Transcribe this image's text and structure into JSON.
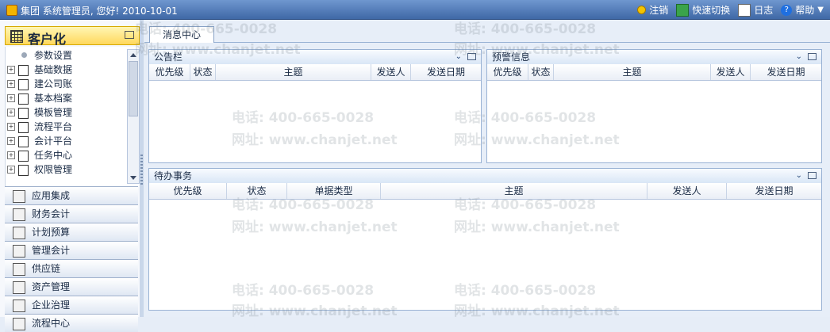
{
  "topbar": {
    "title": "集团 系统管理员, 您好! 2010-10-01",
    "actions": [
      "注销",
      "快速切换",
      "日志",
      "帮助"
    ]
  },
  "sidebar": {
    "header": "客户化",
    "tree": [
      "参数设置",
      "基础数据",
      "建公司账",
      "基本档案",
      "模板管理",
      "流程平台",
      "会计平台",
      "任务中心",
      "权限管理"
    ],
    "modules": [
      "应用集成",
      "财务会计",
      "计划预算",
      "管理会计",
      "供应链",
      "资产管理",
      "企业治理",
      "流程中心"
    ]
  },
  "main": {
    "tab": "消息中心",
    "bulletin": {
      "title": "公告栏",
      "columns": [
        "优先级",
        "状态",
        "主题",
        "发送人",
        "发送日期"
      ]
    },
    "alerts": {
      "title": "预警信息",
      "columns": [
        "优先级",
        "状态",
        "主题",
        "发送人",
        "发送日期"
      ]
    },
    "todo": {
      "title": "待办事务",
      "columns": [
        "优先级",
        "状态",
        "单据类型",
        "主题",
        "发送人",
        "发送日期"
      ]
    }
  },
  "watermark": {
    "phone": "电话: 400-665-0028",
    "url": "网址: www.chanjet.net"
  }
}
